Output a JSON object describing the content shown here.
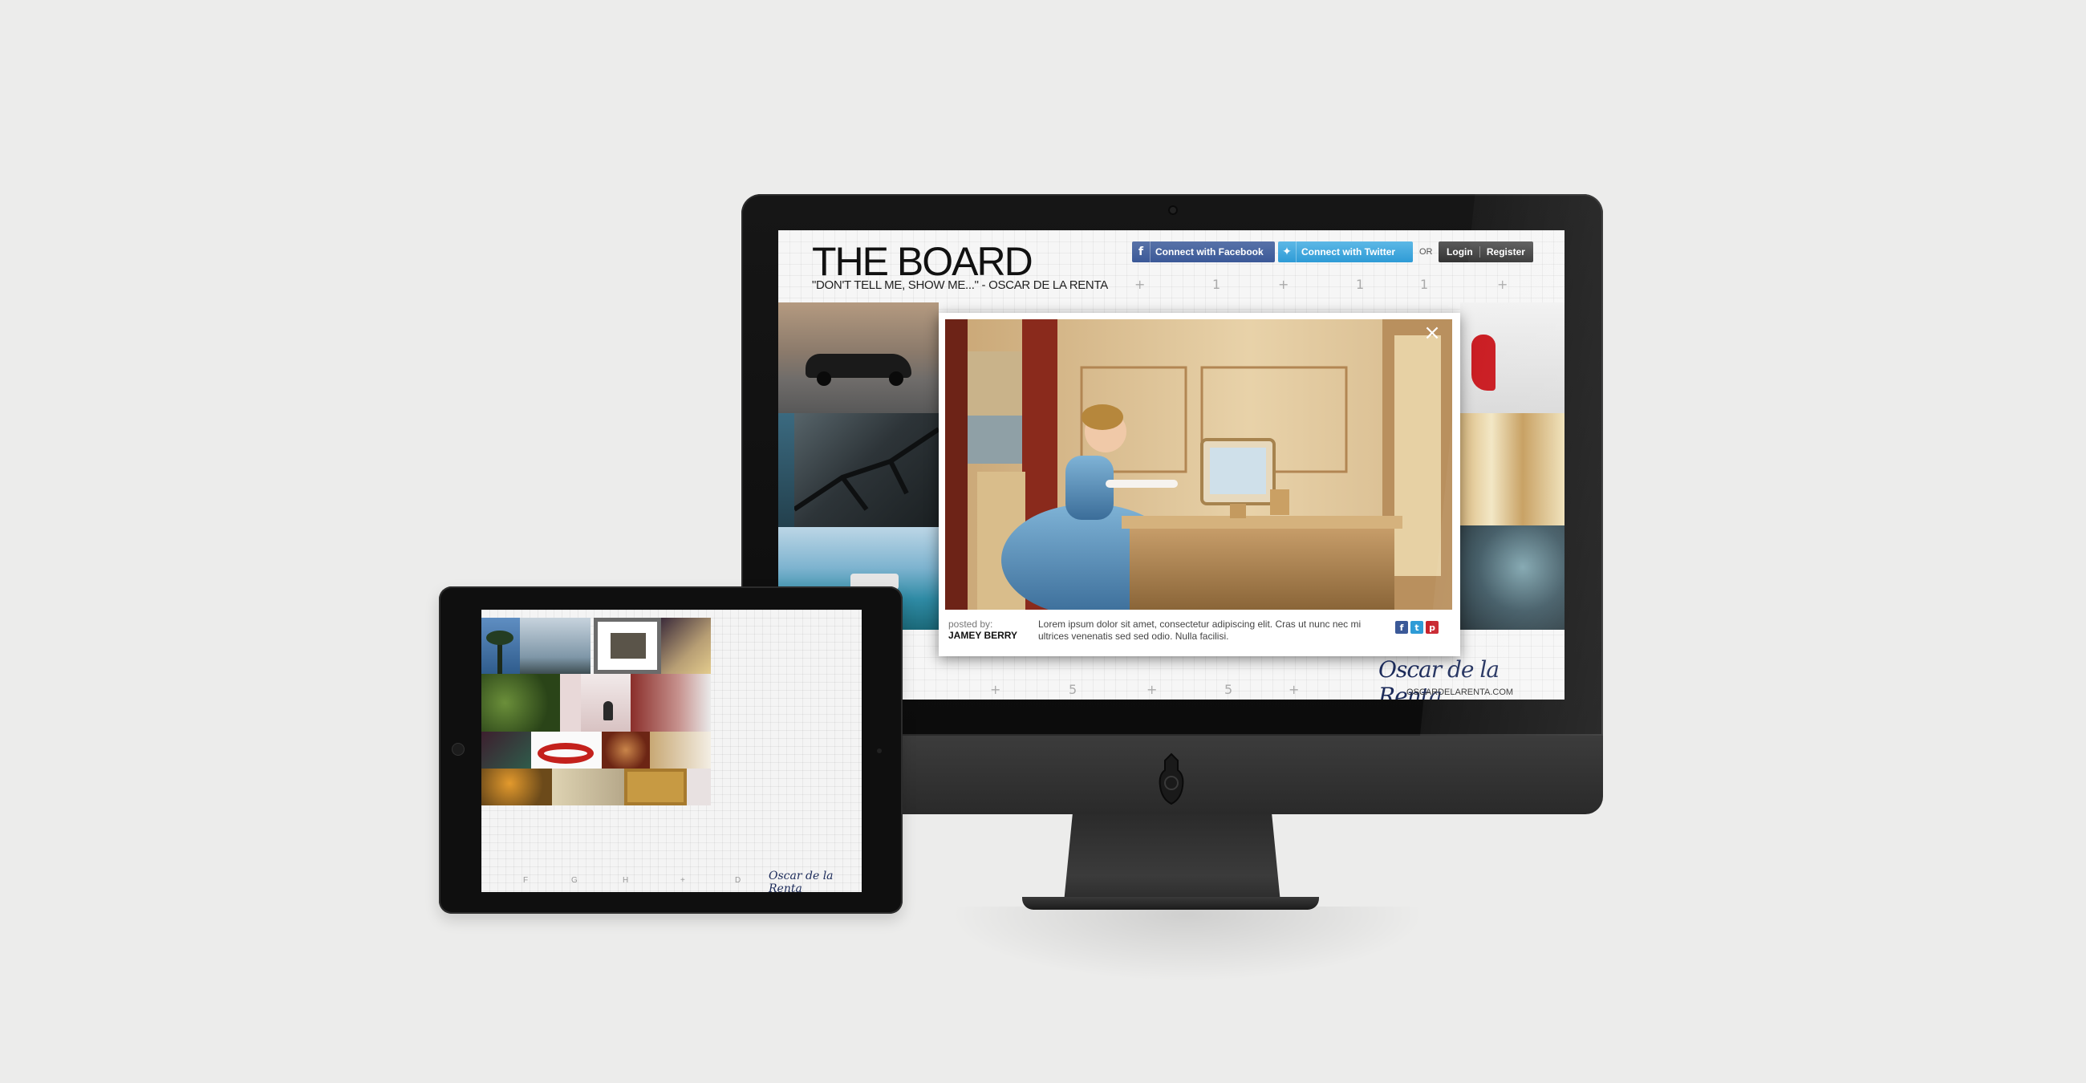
{
  "board": {
    "title": "THE BOARD",
    "subtitle": "\"DON'T TELL ME, SHOW ME...\" - OSCAR DE LA RENTA"
  },
  "auth": {
    "facebook_label": "Connect with Facebook",
    "twitter_label": "Connect with Twitter",
    "or_label": "OR",
    "login_label": "Login",
    "register_label": "Register"
  },
  "grid_marks_top": [
    "+",
    "1",
    "+",
    "1",
    "1",
    "+"
  ],
  "grid_marks_bottom": [
    "+",
    "5",
    "+",
    "5",
    "+"
  ],
  "modal": {
    "posted_by_label": "posted by:",
    "author": "JAMEY BERRY",
    "description": "Lorem ipsum dolor sit amet, consectetur adipiscing elit. Cras ut nunc nec mi ultrices venenatis sed sed odio. Nulla facilisi.",
    "close_icon": "×"
  },
  "brand": {
    "script": "Oscar de la Renta",
    "url": "OSCARDELARENTA.COM"
  },
  "ipad": {
    "bottom_letters": [
      "F",
      "G",
      "H",
      "+",
      "D"
    ],
    "brand_script": "Oscar de la Renta"
  },
  "colors": {
    "facebook": "#3b5998",
    "twitter": "#2e9bd6",
    "brand_navy": "#1c2b5a"
  }
}
